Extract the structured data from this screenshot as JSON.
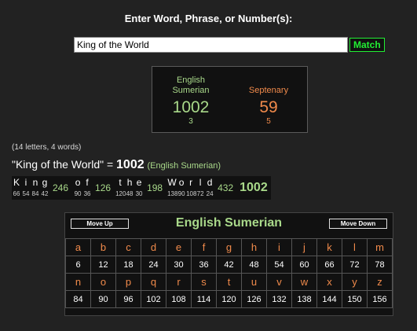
{
  "header": {
    "prompt": "Enter Word, Phrase, or Number(s):"
  },
  "search": {
    "value": "King of the World",
    "match_label": "Match"
  },
  "result": {
    "english": {
      "label_line1": "English",
      "label_line2": "Sumerian",
      "value": "1002",
      "reduction": "3"
    },
    "septenary": {
      "label": "Septenary",
      "value": "59",
      "reduction": "5"
    }
  },
  "summary": {
    "counts": "(14 letters, 4 words)",
    "phrase": "\"King of the World\" = ",
    "total": "1002",
    "cipher_name": "(English Sumerian)"
  },
  "breakdown": {
    "words": [
      {
        "letters": [
          {
            "ch": "K",
            "val": "66"
          },
          {
            "ch": "i",
            "val": "54"
          },
          {
            "ch": "n",
            "val": "84"
          },
          {
            "ch": "g",
            "val": "42"
          }
        ],
        "total": "246"
      },
      {
        "letters": [
          {
            "ch": "o",
            "val": "90"
          },
          {
            "ch": "f",
            "val": "36"
          }
        ],
        "total": "126"
      },
      {
        "letters": [
          {
            "ch": "t",
            "val": "120"
          },
          {
            "ch": "h",
            "val": "48"
          },
          {
            "ch": "e",
            "val": "30"
          }
        ],
        "total": "198"
      },
      {
        "letters": [
          {
            "ch": "W",
            "val": "138"
          },
          {
            "ch": "o",
            "val": "90"
          },
          {
            "ch": "r",
            "val": "108"
          },
          {
            "ch": "l",
            "val": "72"
          },
          {
            "ch": "d",
            "val": "24"
          }
        ],
        "total": "432"
      }
    ],
    "grand_total": "1002"
  },
  "cipher_table": {
    "title": "English Sumerian",
    "move_up": "Move Up",
    "move_down": "Move Down",
    "rows": [
      {
        "letters": [
          "a",
          "b",
          "c",
          "d",
          "e",
          "f",
          "g",
          "h",
          "i",
          "j",
          "k",
          "l",
          "m"
        ],
        "values": [
          "6",
          "12",
          "18",
          "24",
          "30",
          "36",
          "42",
          "48",
          "54",
          "60",
          "66",
          "72",
          "78"
        ]
      },
      {
        "letters": [
          "n",
          "o",
          "p",
          "q",
          "r",
          "s",
          "t",
          "u",
          "v",
          "w",
          "x",
          "y",
          "z"
        ],
        "values": [
          "84",
          "90",
          "96",
          "102",
          "108",
          "114",
          "120",
          "126",
          "132",
          "138",
          "144",
          "150",
          "156"
        ]
      }
    ]
  },
  "colors": {
    "background": "#222222",
    "english_green": "#a9d98a",
    "septenary_orange": "#f08a4b",
    "match_green": "#22ee33"
  }
}
